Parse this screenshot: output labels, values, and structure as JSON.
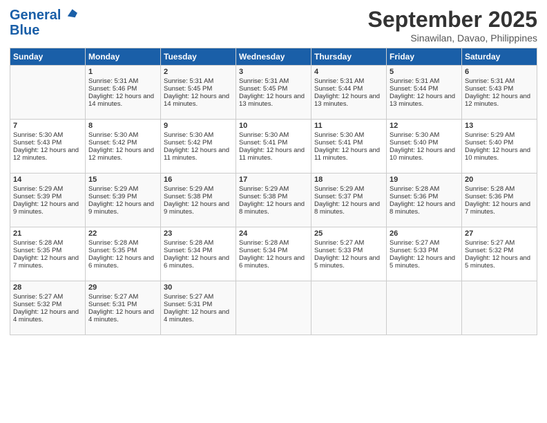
{
  "header": {
    "logo_line1": "General",
    "logo_line2": "Blue",
    "month": "September 2025",
    "location": "Sinawilan, Davao, Philippines"
  },
  "days_of_week": [
    "Sunday",
    "Monday",
    "Tuesday",
    "Wednesday",
    "Thursday",
    "Friday",
    "Saturday"
  ],
  "weeks": [
    [
      {
        "day": "",
        "sunrise": "",
        "sunset": "",
        "daylight": ""
      },
      {
        "day": "1",
        "sunrise": "Sunrise: 5:31 AM",
        "sunset": "Sunset: 5:46 PM",
        "daylight": "Daylight: 12 hours and 14 minutes."
      },
      {
        "day": "2",
        "sunrise": "Sunrise: 5:31 AM",
        "sunset": "Sunset: 5:45 PM",
        "daylight": "Daylight: 12 hours and 14 minutes."
      },
      {
        "day": "3",
        "sunrise": "Sunrise: 5:31 AM",
        "sunset": "Sunset: 5:45 PM",
        "daylight": "Daylight: 12 hours and 13 minutes."
      },
      {
        "day": "4",
        "sunrise": "Sunrise: 5:31 AM",
        "sunset": "Sunset: 5:44 PM",
        "daylight": "Daylight: 12 hours and 13 minutes."
      },
      {
        "day": "5",
        "sunrise": "Sunrise: 5:31 AM",
        "sunset": "Sunset: 5:44 PM",
        "daylight": "Daylight: 12 hours and 13 minutes."
      },
      {
        "day": "6",
        "sunrise": "Sunrise: 5:31 AM",
        "sunset": "Sunset: 5:43 PM",
        "daylight": "Daylight: 12 hours and 12 minutes."
      }
    ],
    [
      {
        "day": "7",
        "sunrise": "Sunrise: 5:30 AM",
        "sunset": "Sunset: 5:43 PM",
        "daylight": "Daylight: 12 hours and 12 minutes."
      },
      {
        "day": "8",
        "sunrise": "Sunrise: 5:30 AM",
        "sunset": "Sunset: 5:42 PM",
        "daylight": "Daylight: 12 hours and 12 minutes."
      },
      {
        "day": "9",
        "sunrise": "Sunrise: 5:30 AM",
        "sunset": "Sunset: 5:42 PM",
        "daylight": "Daylight: 12 hours and 11 minutes."
      },
      {
        "day": "10",
        "sunrise": "Sunrise: 5:30 AM",
        "sunset": "Sunset: 5:41 PM",
        "daylight": "Daylight: 12 hours and 11 minutes."
      },
      {
        "day": "11",
        "sunrise": "Sunrise: 5:30 AM",
        "sunset": "Sunset: 5:41 PM",
        "daylight": "Daylight: 12 hours and 11 minutes."
      },
      {
        "day": "12",
        "sunrise": "Sunrise: 5:30 AM",
        "sunset": "Sunset: 5:40 PM",
        "daylight": "Daylight: 12 hours and 10 minutes."
      },
      {
        "day": "13",
        "sunrise": "Sunrise: 5:29 AM",
        "sunset": "Sunset: 5:40 PM",
        "daylight": "Daylight: 12 hours and 10 minutes."
      }
    ],
    [
      {
        "day": "14",
        "sunrise": "Sunrise: 5:29 AM",
        "sunset": "Sunset: 5:39 PM",
        "daylight": "Daylight: 12 hours and 9 minutes."
      },
      {
        "day": "15",
        "sunrise": "Sunrise: 5:29 AM",
        "sunset": "Sunset: 5:39 PM",
        "daylight": "Daylight: 12 hours and 9 minutes."
      },
      {
        "day": "16",
        "sunrise": "Sunrise: 5:29 AM",
        "sunset": "Sunset: 5:38 PM",
        "daylight": "Daylight: 12 hours and 9 minutes."
      },
      {
        "day": "17",
        "sunrise": "Sunrise: 5:29 AM",
        "sunset": "Sunset: 5:38 PM",
        "daylight": "Daylight: 12 hours and 8 minutes."
      },
      {
        "day": "18",
        "sunrise": "Sunrise: 5:29 AM",
        "sunset": "Sunset: 5:37 PM",
        "daylight": "Daylight: 12 hours and 8 minutes."
      },
      {
        "day": "19",
        "sunrise": "Sunrise: 5:28 AM",
        "sunset": "Sunset: 5:36 PM",
        "daylight": "Daylight: 12 hours and 8 minutes."
      },
      {
        "day": "20",
        "sunrise": "Sunrise: 5:28 AM",
        "sunset": "Sunset: 5:36 PM",
        "daylight": "Daylight: 12 hours and 7 minutes."
      }
    ],
    [
      {
        "day": "21",
        "sunrise": "Sunrise: 5:28 AM",
        "sunset": "Sunset: 5:35 PM",
        "daylight": "Daylight: 12 hours and 7 minutes."
      },
      {
        "day": "22",
        "sunrise": "Sunrise: 5:28 AM",
        "sunset": "Sunset: 5:35 PM",
        "daylight": "Daylight: 12 hours and 6 minutes."
      },
      {
        "day": "23",
        "sunrise": "Sunrise: 5:28 AM",
        "sunset": "Sunset: 5:34 PM",
        "daylight": "Daylight: 12 hours and 6 minutes."
      },
      {
        "day": "24",
        "sunrise": "Sunrise: 5:28 AM",
        "sunset": "Sunset: 5:34 PM",
        "daylight": "Daylight: 12 hours and 6 minutes."
      },
      {
        "day": "25",
        "sunrise": "Sunrise: 5:27 AM",
        "sunset": "Sunset: 5:33 PM",
        "daylight": "Daylight: 12 hours and 5 minutes."
      },
      {
        "day": "26",
        "sunrise": "Sunrise: 5:27 AM",
        "sunset": "Sunset: 5:33 PM",
        "daylight": "Daylight: 12 hours and 5 minutes."
      },
      {
        "day": "27",
        "sunrise": "Sunrise: 5:27 AM",
        "sunset": "Sunset: 5:32 PM",
        "daylight": "Daylight: 12 hours and 5 minutes."
      }
    ],
    [
      {
        "day": "28",
        "sunrise": "Sunrise: 5:27 AM",
        "sunset": "Sunset: 5:32 PM",
        "daylight": "Daylight: 12 hours and 4 minutes."
      },
      {
        "day": "29",
        "sunrise": "Sunrise: 5:27 AM",
        "sunset": "Sunset: 5:31 PM",
        "daylight": "Daylight: 12 hours and 4 minutes."
      },
      {
        "day": "30",
        "sunrise": "Sunrise: 5:27 AM",
        "sunset": "Sunset: 5:31 PM",
        "daylight": "Daylight: 12 hours and 4 minutes."
      },
      {
        "day": "",
        "sunrise": "",
        "sunset": "",
        "daylight": ""
      },
      {
        "day": "",
        "sunrise": "",
        "sunset": "",
        "daylight": ""
      },
      {
        "day": "",
        "sunrise": "",
        "sunset": "",
        "daylight": ""
      },
      {
        "day": "",
        "sunrise": "",
        "sunset": "",
        "daylight": ""
      }
    ]
  ]
}
